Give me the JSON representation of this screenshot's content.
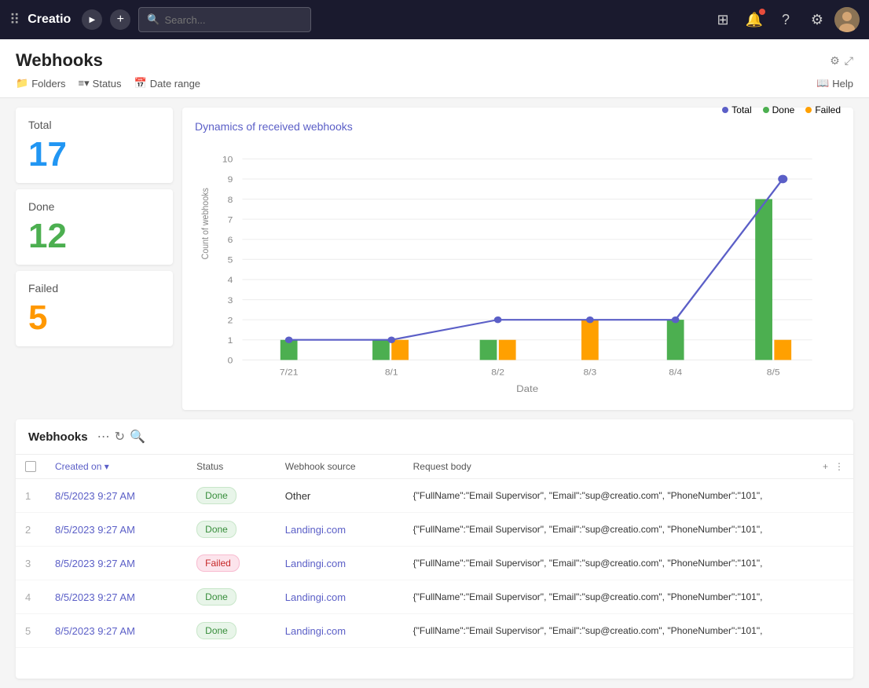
{
  "topnav": {
    "logo": "Creatio",
    "search_placeholder": "Search...",
    "icons": [
      "grid",
      "play",
      "plus",
      "apps",
      "bell",
      "help",
      "settings",
      "avatar"
    ]
  },
  "page": {
    "title": "Webhooks",
    "filters": [
      {
        "icon": "📁",
        "label": "Folders"
      },
      {
        "icon": "≡",
        "label": "Status"
      },
      {
        "icon": "📅",
        "label": "Date range"
      }
    ],
    "help_label": "Help",
    "settings_icon": "⚙",
    "expand_icon": "⤢"
  },
  "stats": {
    "total": {
      "label": "Total",
      "value": "17"
    },
    "done": {
      "label": "Done",
      "value": "12"
    },
    "failed": {
      "label": "Failed",
      "value": "5"
    }
  },
  "chart": {
    "title": "Dynamics of received webhooks",
    "legend": [
      {
        "label": "Total",
        "color": "#5b5fc7"
      },
      {
        "label": "Done",
        "color": "#4caf50"
      },
      {
        "label": "Failed",
        "color": "#ffa000"
      }
    ],
    "y_axis_label": "Count of webhooks",
    "x_axis_label": "Date",
    "dates": [
      "7/21",
      "8/1",
      "8/2",
      "8/3",
      "8/4",
      "8/5"
    ],
    "total_line": [
      1,
      1,
      2,
      2,
      2,
      9
    ],
    "done_bars": [
      1,
      1,
      1,
      0,
      2,
      8
    ],
    "failed_bars": [
      0,
      1,
      1,
      2,
      0,
      1
    ],
    "y_max": 10
  },
  "webhooks_table": {
    "section_title": "Webhooks",
    "columns": [
      {
        "key": "checkbox",
        "label": ""
      },
      {
        "key": "created_on",
        "label": "Created on"
      },
      {
        "key": "status",
        "label": "Status"
      },
      {
        "key": "source",
        "label": "Webhook source"
      },
      {
        "key": "body",
        "label": "Request body"
      }
    ],
    "rows": [
      {
        "num": 1,
        "created": "8/5/2023 9:27 AM",
        "status": "Done",
        "source": "Other",
        "body": "{\"FullName\":\"Email Supervisor\", \"Email\":\"sup@creatio.com\", \"PhoneNumber\":\"101\","
      },
      {
        "num": 2,
        "created": "8/5/2023 9:27 AM",
        "status": "Done",
        "source": "Landingi.com",
        "body": "{\"FullName\":\"Email Supervisor\", \"Email\":\"sup@creatio.com\", \"PhoneNumber\":\"101\","
      },
      {
        "num": 3,
        "created": "8/5/2023 9:27 AM",
        "status": "Failed",
        "source": "Landingi.com",
        "body": "{\"FullName\":\"Email Supervisor\", \"Email\":\"sup@creatio.com\", \"PhoneNumber\":\"101\","
      },
      {
        "num": 4,
        "created": "8/5/2023 9:27 AM",
        "status": "Done",
        "source": "Landingi.com",
        "body": "{\"FullName\":\"Email Supervisor\", \"Email\":\"sup@creatio.com\", \"PhoneNumber\":\"101\","
      },
      {
        "num": 5,
        "created": "8/5/2023 9:27 AM",
        "status": "Done",
        "source": "Landingi.com",
        "body": "{\"FullName\":\"Email Supervisor\", \"Email\":\"sup@creatio.com\", \"PhoneNumber\":\"101\","
      }
    ]
  }
}
